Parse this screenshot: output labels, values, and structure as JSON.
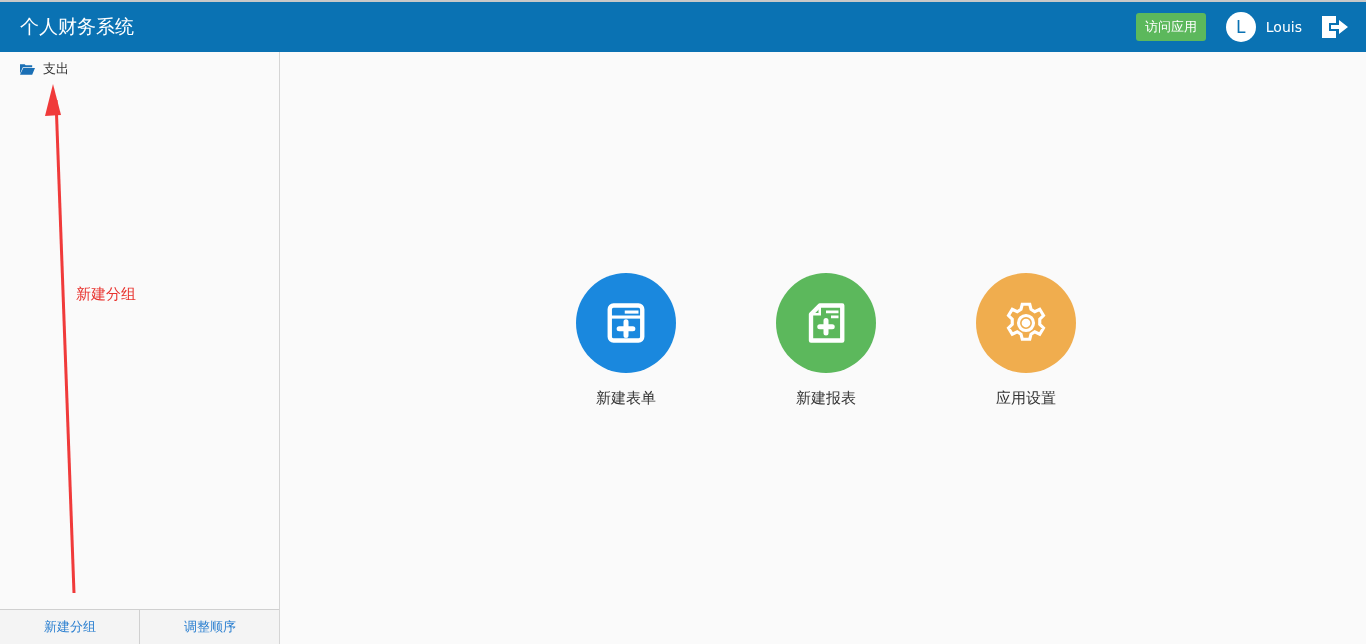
{
  "header": {
    "title": "个人财务系统",
    "visit_button": "访问应用",
    "user": {
      "initial": "L",
      "name": "Louis"
    }
  },
  "sidebar": {
    "groups": [
      {
        "label": "支出"
      }
    ],
    "footer_buttons": [
      "新建分组",
      "调整顺序"
    ]
  },
  "actions": [
    {
      "kind": "form",
      "label": "新建表单",
      "color": "#1a88de"
    },
    {
      "kind": "report",
      "label": "新建报表",
      "color": "#5cb85c"
    },
    {
      "kind": "settings",
      "label": "应用设置",
      "color": "#f0ad4e"
    }
  ],
  "annotation": {
    "label": "新建分组"
  }
}
